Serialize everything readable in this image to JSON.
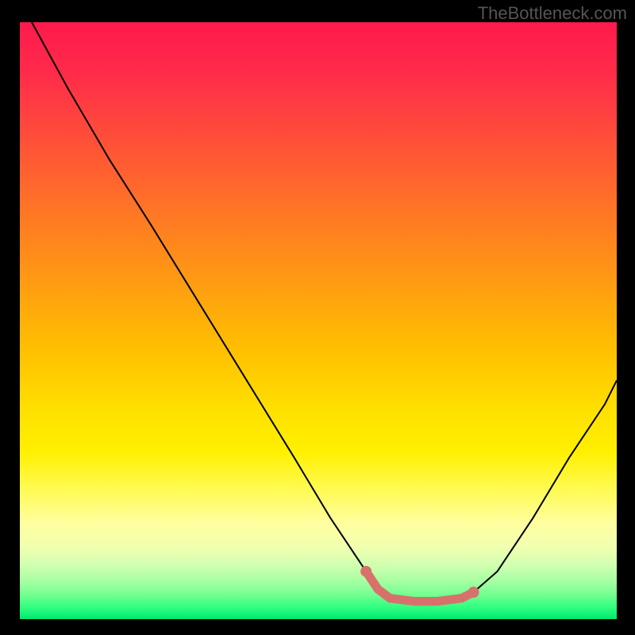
{
  "watermark": "TheBottleneck.com",
  "chart_data": {
    "type": "line",
    "title": "",
    "xlabel": "",
    "ylabel": "",
    "xlim": [
      0,
      100
    ],
    "ylim": [
      0,
      100
    ],
    "series": [
      {
        "name": "bottleneck-curve",
        "color": "#000000",
        "x": [
          2,
          8,
          15,
          22,
          30,
          38,
          46,
          52,
          58,
          60,
          62,
          66,
          70,
          74,
          76,
          80,
          86,
          92,
          98,
          100
        ],
        "y": [
          100,
          89,
          77,
          66,
          53,
          40,
          27,
          17,
          8,
          5,
          3.5,
          3,
          3,
          3.5,
          4.5,
          8,
          17,
          27,
          36,
          40
        ]
      },
      {
        "name": "highlight-zone",
        "color": "#d8716b",
        "x": [
          58,
          60,
          62,
          66,
          70,
          74,
          76
        ],
        "y": [
          8,
          5,
          3.5,
          3,
          3,
          3.5,
          4.5
        ]
      }
    ],
    "highlight_color": "#d8716b",
    "gradient_stops": [
      {
        "pos": 0,
        "color": "#ff1a4d"
      },
      {
        "pos": 50,
        "color": "#ffc000"
      },
      {
        "pos": 85,
        "color": "#ffffa0"
      },
      {
        "pos": 100,
        "color": "#00e870"
      }
    ]
  }
}
